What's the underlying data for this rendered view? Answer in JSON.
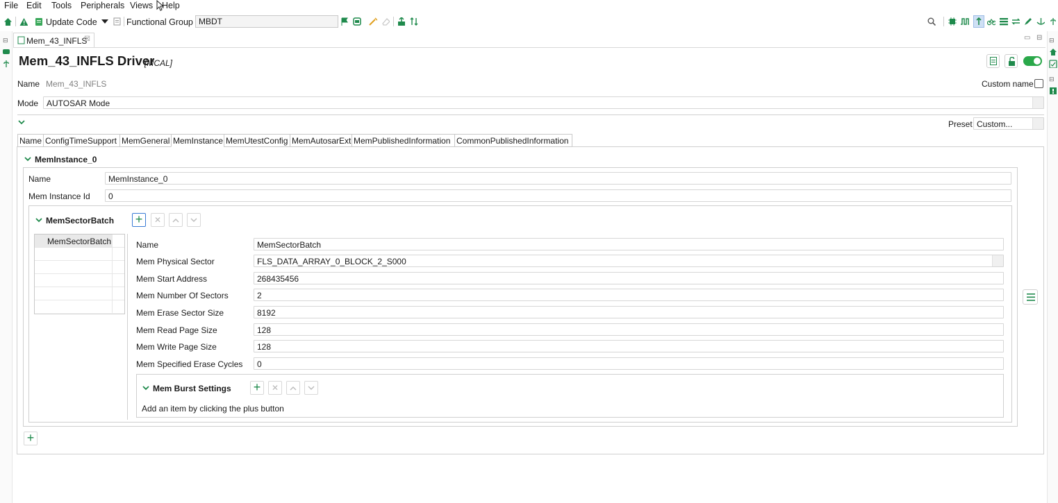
{
  "menu": [
    "File",
    "Edit",
    "Tools",
    "Peripherals",
    "Views",
    "Help"
  ],
  "toolbar": {
    "update_code_label": "Update Code",
    "functional_group_label": "Functional Group",
    "functional_group_value": "MBDT"
  },
  "editor_tab": {
    "label": "Mem_43_INFLS",
    "close_glyph": "☒"
  },
  "header": {
    "title": "Mem_43_INFLS Driver",
    "subtitle": "[MCAL]",
    "name_label": "Name",
    "name_value": "Mem_43_INFLS",
    "custom_name_label": "Custom name",
    "mode_label": "Mode",
    "mode_value": "AUTOSAR Mode",
    "preset_label": "Preset",
    "preset_value": "Custom..."
  },
  "config_tabs": [
    "Name",
    "ConfigTimeSupport",
    "MemGeneral",
    "MemInstance",
    "MemUtestConfig",
    "MemAutosarExt",
    "MemPublishedInformation",
    "CommonPublishedInformation"
  ],
  "active_tab": "MemInstance",
  "instance": {
    "title": "MemInstance_0",
    "name_label": "Name",
    "name_value": "MemInstance_0",
    "id_label": "Mem Instance Id",
    "id_value": "0"
  },
  "sector_batch": {
    "title": "MemSectorBatch",
    "list_items": [
      "MemSectorBatch",
      "",
      "",
      "",
      "",
      ""
    ],
    "fields": [
      {
        "label": "Name",
        "value": "MemSectorBatch"
      },
      {
        "label": "Mem Physical Sector",
        "value": "FLS_DATA_ARRAY_0_BLOCK_2_S000"
      },
      {
        "label": "Mem Start Address",
        "value": "268435456"
      },
      {
        "label": "Mem Number Of Sectors",
        "value": "2"
      },
      {
        "label": "Mem Erase Sector Size",
        "value": "8192"
      },
      {
        "label": "Mem Read Page Size",
        "value": "128"
      },
      {
        "label": "Mem Write Page Size",
        "value": "128"
      },
      {
        "label": "Mem Specified Erase Cycles",
        "value": "0"
      }
    ]
  },
  "burst_settings": {
    "title": "Mem Burst Settings",
    "empty_hint": "Add an item by clicking the plus button"
  },
  "colors": {
    "accent_green": "#1f8a4c",
    "toggle_on": "#2aa84a"
  }
}
